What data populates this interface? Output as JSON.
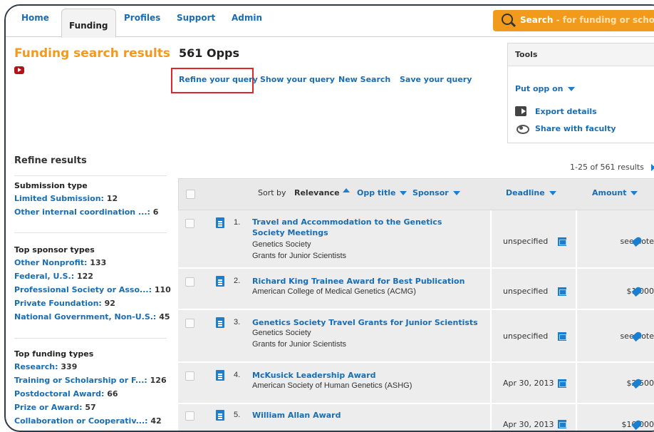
{
  "nav": {
    "tabs": [
      {
        "label": "Home",
        "active": false
      },
      {
        "label": "Funding",
        "active": true
      },
      {
        "label": "Profiles",
        "active": false
      },
      {
        "label": "Support",
        "active": false
      },
      {
        "label": "Admin",
        "active": false
      }
    ],
    "search_label": "Search",
    "search_hint": " - for funding or scholars",
    "accent": "#f29a1c"
  },
  "page": {
    "title": "Funding search results",
    "count": "561 Opps"
  },
  "query_links": [
    "Refine your query",
    "Show your query",
    "New Search",
    "Save your query"
  ],
  "tools": {
    "heading": "Tools",
    "put_opp_on": "Put opp on",
    "export": "Export details",
    "share": "Share with faculty"
  },
  "refine": {
    "heading": "Refine results",
    "groups": [
      {
        "title": "Submission type",
        "items": [
          {
            "label": "Limited Submission:",
            "count": "12"
          },
          {
            "label": "Other internal coordination ...:",
            "count": "6"
          }
        ]
      },
      {
        "title": "Top sponsor types",
        "items": [
          {
            "label": "Other Nonprofit:",
            "count": "133"
          },
          {
            "label": "Federal, U.S.:",
            "count": "122"
          },
          {
            "label": "Professional Society or Asso...:",
            "count": "110"
          },
          {
            "label": "Private Foundation:",
            "count": "92"
          },
          {
            "label": "National Government, Non-U.S.:",
            "count": "45"
          }
        ]
      },
      {
        "title": "Top funding types",
        "items": [
          {
            "label": "Research:",
            "count": "339"
          },
          {
            "label": "Training or Scholarship or F...:",
            "count": "126"
          },
          {
            "label": "Postdoctoral Award:",
            "count": "66"
          },
          {
            "label": "Prize or Award:",
            "count": "57"
          },
          {
            "label": "Collaboration or Cooperativ...:",
            "count": "42"
          }
        ]
      }
    ]
  },
  "results": {
    "range": "1-25 of 561 results",
    "header": {
      "sort_by": "Sort by",
      "relevance": "Relevance",
      "opp_title": "Opp title",
      "sponsor": "Sponsor",
      "deadline": "Deadline",
      "amount": "Amount"
    },
    "rows": [
      {
        "num": "1.",
        "title": "Travel and Accommodation to the Genetics Society Meetings",
        "sponsor": "Genetics Society",
        "program": "Grants for Junior Scientists",
        "deadline": "unspecified",
        "amount": "see note"
      },
      {
        "num": "2.",
        "title": "Richard King Trainee Award for Best Publication",
        "sponsor": "American College of Medical Genetics (ACMG)",
        "program": "",
        "deadline": "unspecified",
        "amount": "$1,000"
      },
      {
        "num": "3.",
        "title": "Genetics Society Travel Grants for Junior Scientists",
        "sponsor": "Genetics Society",
        "program": "Grants for Junior Scientists",
        "deadline": "unspecified",
        "amount": "see note"
      },
      {
        "num": "4.",
        "title": "McKusick Leadership Award",
        "sponsor": "American Society of Human Genetics (ASHG)",
        "program": "",
        "deadline": "Apr 30, 2013",
        "amount": "$2,500"
      },
      {
        "num": "5.",
        "title": "William Allan Award",
        "sponsor": "",
        "program": "",
        "deadline": "Apr 30, 2013",
        "amount": "$10,000"
      }
    ]
  }
}
